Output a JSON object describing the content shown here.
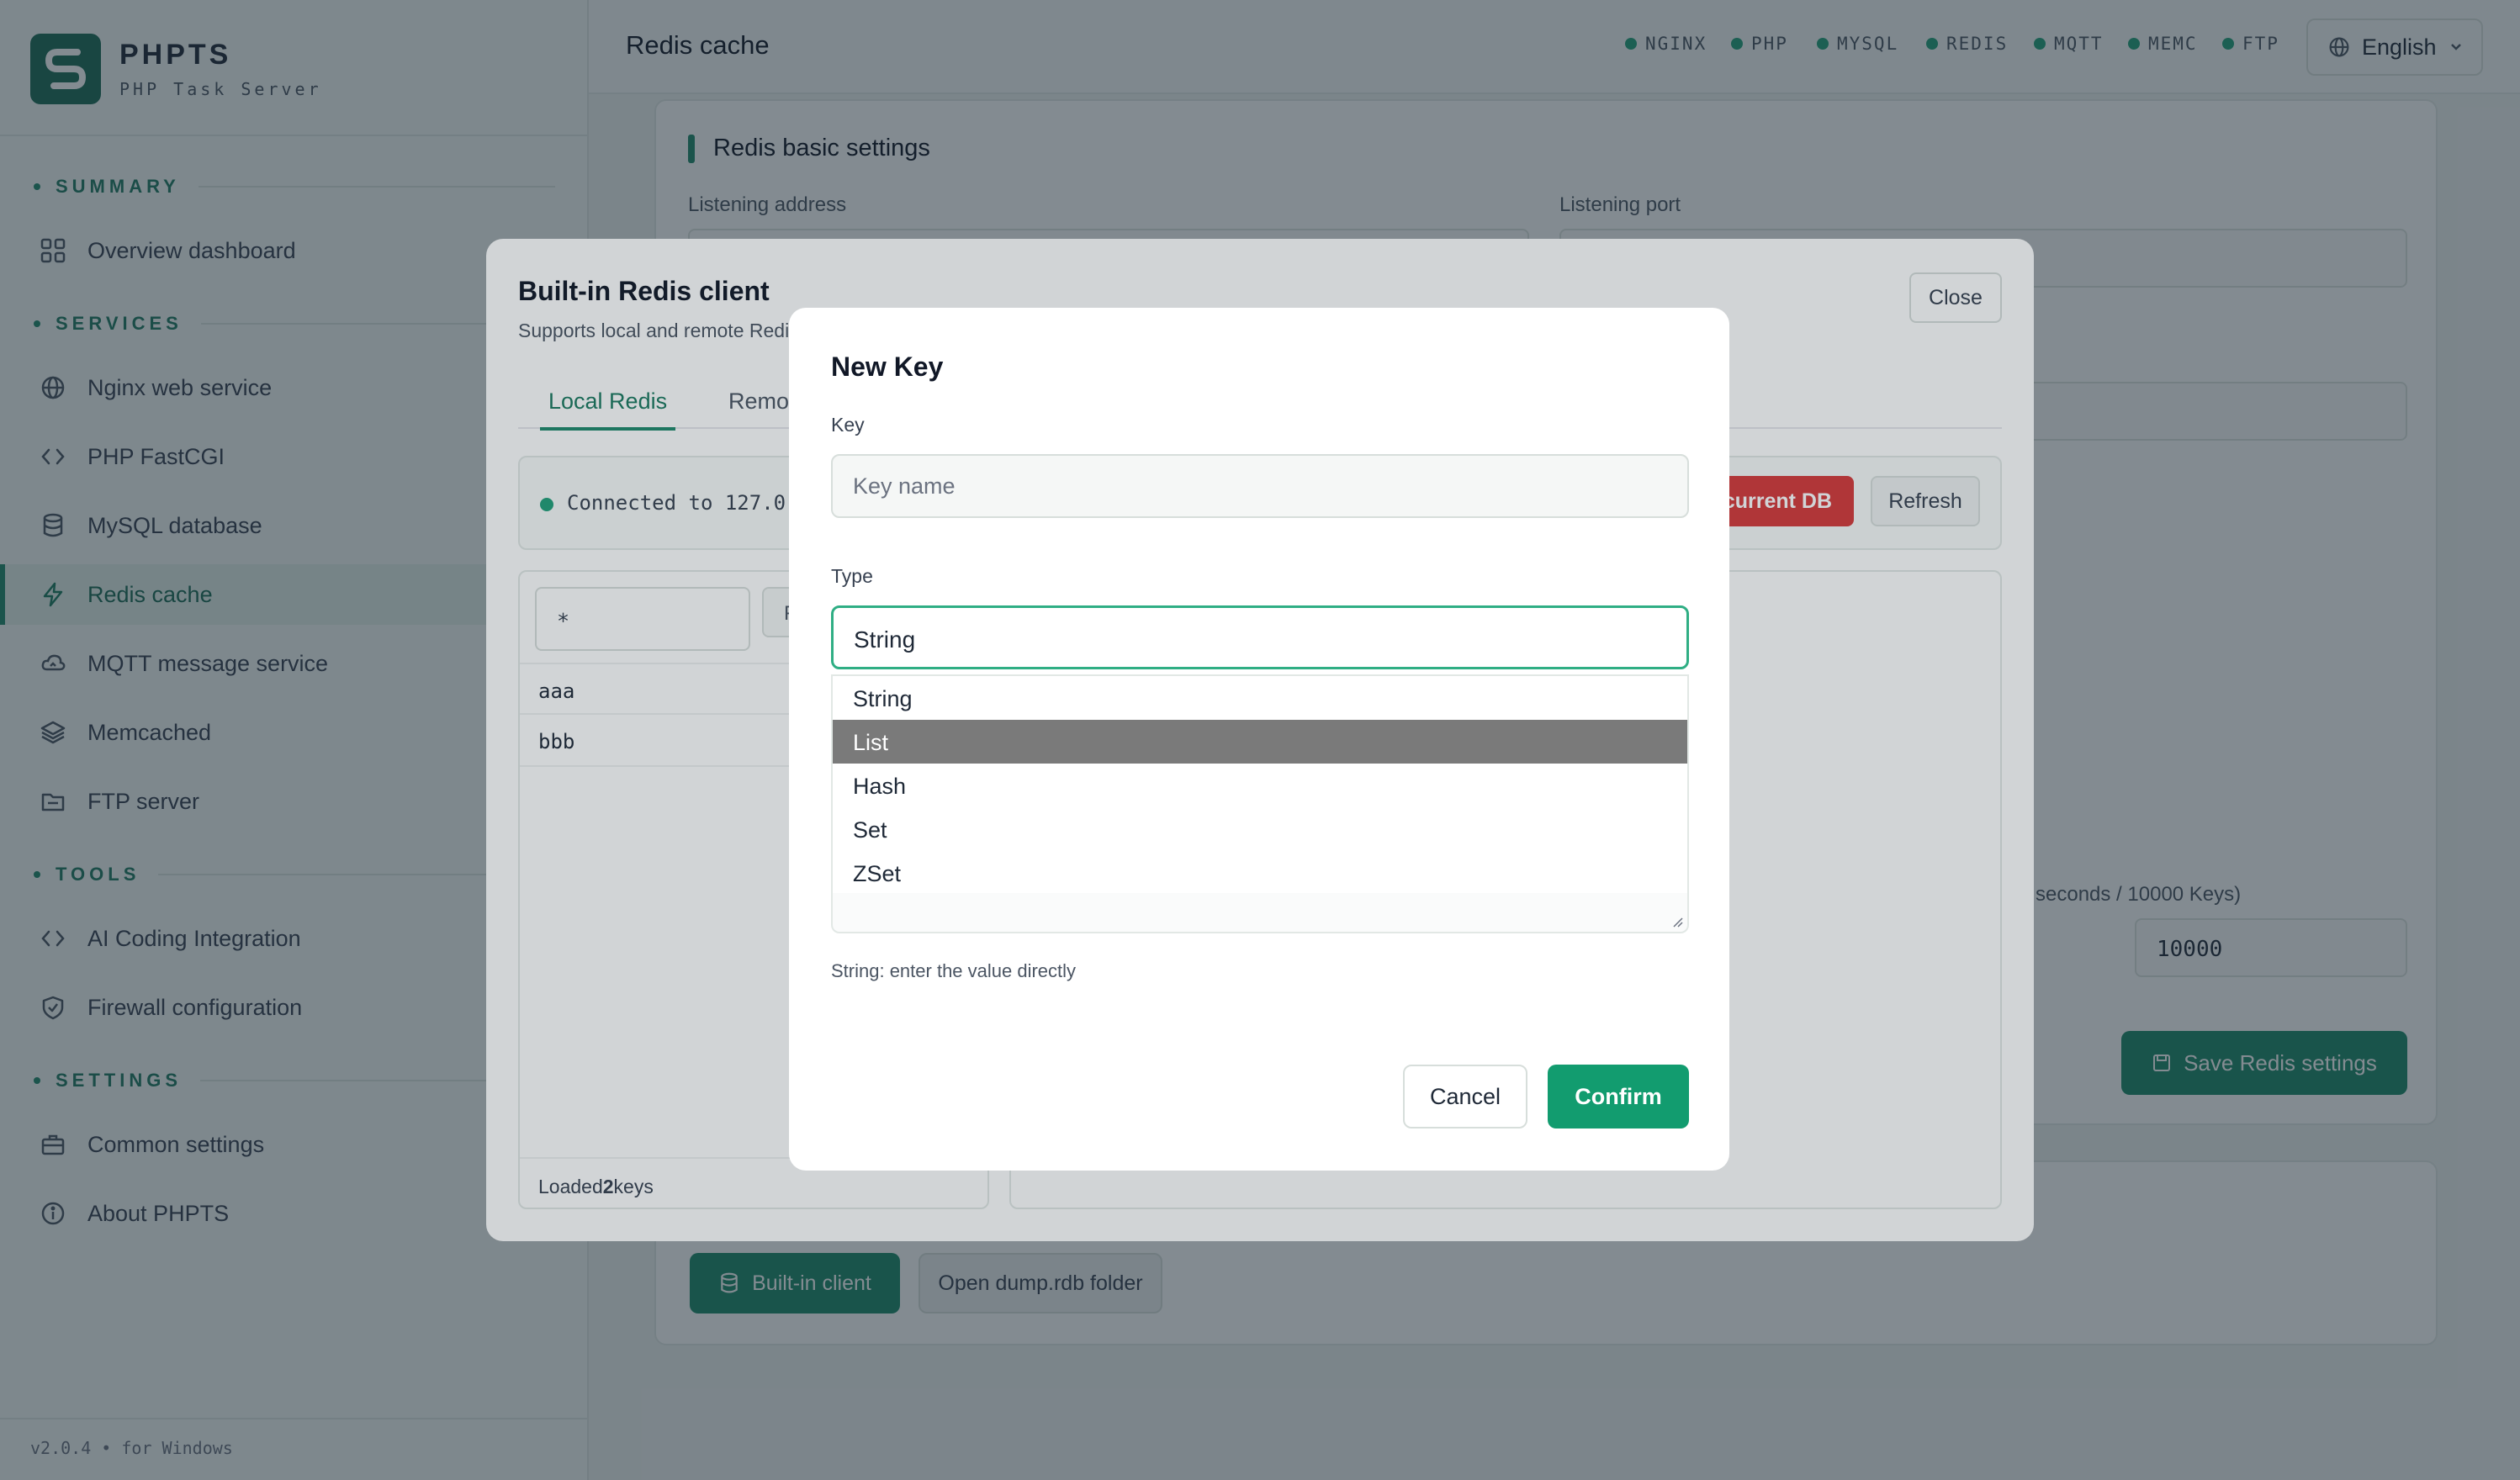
{
  "app": {
    "name": "PHPTS",
    "subtitle": "PHP Task Server",
    "version": "v2.0.4 • for Windows"
  },
  "sidebar": {
    "sections": [
      {
        "label": "SUMMARY"
      },
      {
        "label": "SERVICES"
      },
      {
        "label": "TOOLS"
      },
      {
        "label": "SETTINGS"
      }
    ],
    "items": [
      {
        "label": "Overview dashboard",
        "icon": "grid-icon"
      },
      {
        "label": "Nginx web service",
        "icon": "globe-icon"
      },
      {
        "label": "PHP FastCGI",
        "icon": "code-icon"
      },
      {
        "label": "MySQL database",
        "icon": "database-icon"
      },
      {
        "label": "Redis cache",
        "icon": "bolt-icon",
        "active": true
      },
      {
        "label": "MQTT message service",
        "icon": "cloud-icon"
      },
      {
        "label": "Memcached",
        "icon": "layers-icon"
      },
      {
        "label": "FTP server",
        "icon": "folder-icon"
      },
      {
        "label": "AI Coding Integration",
        "icon": "code-icon"
      },
      {
        "label": "Firewall configuration",
        "icon": "shield-icon"
      },
      {
        "label": "Common settings",
        "icon": "briefcase-icon"
      },
      {
        "label": "About PHPTS",
        "icon": "info-icon"
      }
    ]
  },
  "header": {
    "title": "Redis cache",
    "services": [
      "NGINX",
      "PHP",
      "MYSQL",
      "REDIS",
      "MQTT",
      "MEMC",
      "FTP"
    ],
    "language": "English",
    "status_color": "#22a07a"
  },
  "background": {
    "card_title": "Redis basic settings",
    "listen_address_label": "Listening address",
    "listen_port_label": "Listening port",
    "ttl_label_fragment": "seconds / 10000 Keys)",
    "max_keys_value": "10000",
    "save_button": "Save Redis settings",
    "builtin_client_button": "Built-in client",
    "open_dump_button": "Open dump.rdb folder"
  },
  "redis_client": {
    "title": "Built-in Redis client",
    "subtitle": "Supports local and remote Redi",
    "close": "Close",
    "tabs": [
      "Local Redis",
      "Remo"
    ],
    "connection": "Connected to 127.0.",
    "flush_button": "current DB",
    "refresh_button": "Refresh",
    "pattern": "*",
    "pattern_button": "F",
    "keys": [
      "aaa",
      "bbb"
    ],
    "loaded_prefix": "Loaded",
    "loaded_count": "2",
    "loaded_suffix": "keys"
  },
  "new_key": {
    "title": "New Key",
    "key_label": "Key",
    "key_placeholder": "Key name",
    "type_label": "Type",
    "type_value": "String",
    "type_options": [
      "String",
      "List",
      "Hash",
      "Set",
      "ZSet"
    ],
    "highlighted_option": "List",
    "hint": "String: enter the value directly",
    "cancel": "Cancel",
    "confirm": "Confirm"
  },
  "colors": {
    "accent": "#1f8a6c",
    "danger": "#d63a3a",
    "confirm": "#129c6f"
  }
}
